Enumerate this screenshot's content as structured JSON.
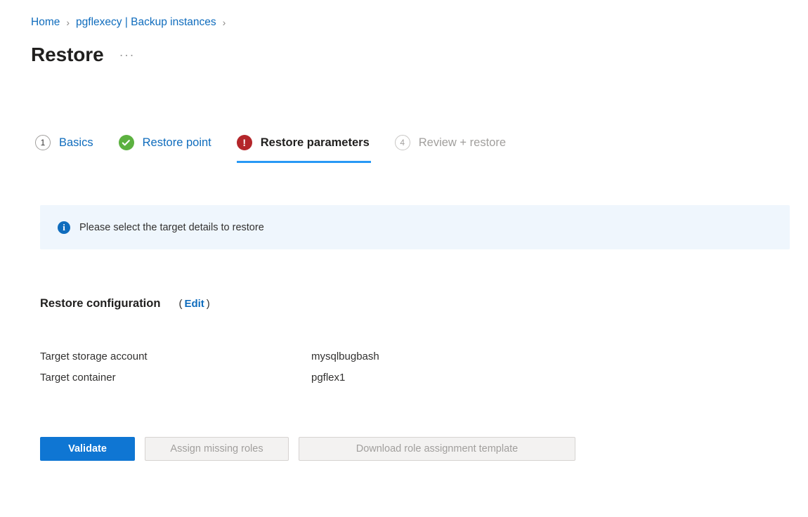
{
  "breadcrumb": {
    "items": [
      {
        "label": "Home"
      },
      {
        "label": "pgflexecy | Backup instances"
      }
    ],
    "separator": "›"
  },
  "header": {
    "title": "Restore",
    "more_actions": "···"
  },
  "wizard": {
    "steps": [
      {
        "label": "Basics",
        "marker": "1",
        "state": "completed-number"
      },
      {
        "label": "Restore point",
        "marker": "check",
        "state": "success"
      },
      {
        "label": "Restore parameters",
        "marker": "!",
        "state": "error-current"
      },
      {
        "label": "Review + restore",
        "marker": "4",
        "state": "disabled"
      }
    ]
  },
  "info_banner": {
    "icon": "info-icon",
    "message": "Please select the target details to restore"
  },
  "restore_configuration": {
    "title": "Restore configuration",
    "paren_open": "(",
    "edit_label": "Edit",
    "paren_close": ")",
    "rows": [
      {
        "label": "Target storage account",
        "value": "mysqlbugbash"
      },
      {
        "label": "Target container",
        "value": "pgflex1"
      }
    ]
  },
  "actions": {
    "validate": "Validate",
    "assign_missing_roles": "Assign missing roles",
    "download_role_assignment_template": "Download role assignment template"
  },
  "colors": {
    "link": "#0f6cbd",
    "primary": "#0f76d3",
    "success": "#5cb140",
    "error": "#b4262a",
    "banner_bg": "#eff6fd",
    "active_underline": "#2899f5"
  }
}
